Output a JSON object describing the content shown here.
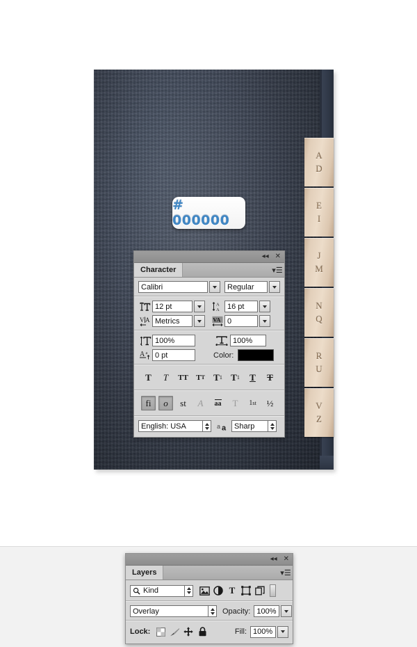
{
  "artwork": {
    "hex_label": "# 000000",
    "hex_label_color": "#3f86c4",
    "cover_color": "#39404e",
    "spine_color": "#2d3543",
    "tab_color": "#e2cfba",
    "tab_text_color": "#8a6f52",
    "index_tabs": [
      {
        "name": "tab-a-d",
        "top": "A",
        "bottom": "D"
      },
      {
        "name": "tab-e-i",
        "top": "E",
        "bottom": "I"
      },
      {
        "name": "tab-j-m",
        "top": "J",
        "bottom": "M"
      },
      {
        "name": "tab-n-q",
        "top": "N",
        "bottom": "Q"
      },
      {
        "name": "tab-r-u",
        "top": "R",
        "bottom": "U"
      },
      {
        "name": "tab-v-z",
        "top": "V",
        "bottom": "Z"
      }
    ]
  },
  "character_panel": {
    "tab_label": "Character",
    "collapse_icon": "◂◂",
    "close_icon": "✕",
    "menu_icon": "▾☰",
    "font_family": {
      "value": "Calibri",
      "icon": "font-family-field"
    },
    "font_style": {
      "value": "Regular",
      "icon": "font-style-field"
    },
    "font_size": {
      "value": "12 pt",
      "icon": "font-size-icon"
    },
    "leading": {
      "value": "16 pt",
      "icon": "leading-icon"
    },
    "kerning": {
      "value": "Metrics",
      "icon": "kerning-icon"
    },
    "tracking": {
      "value": "0",
      "icon": "tracking-icon"
    },
    "vertical_scale": {
      "value": "100%",
      "icon": "vertical-scale-icon"
    },
    "horizontal_scale": {
      "value": "100%",
      "icon": "horizontal-scale-icon"
    },
    "baseline_shift": {
      "value": "0 pt",
      "icon": "baseline-shift-icon"
    },
    "color_label": "Color:",
    "color_value": "#000000",
    "style_buttons": [
      {
        "name": "faux-bold-button",
        "glyph": "T",
        "state": "off"
      },
      {
        "name": "faux-italic-button",
        "glyph": "T",
        "state": "off"
      },
      {
        "name": "all-caps-button",
        "glyph": "TT",
        "state": "off"
      },
      {
        "name": "small-caps-button",
        "glyph": "TT",
        "state": "off"
      },
      {
        "name": "superscript-button",
        "glyph": "T",
        "state": "off"
      },
      {
        "name": "subscript-button",
        "glyph": "T",
        "state": "off"
      },
      {
        "name": "underline-button",
        "glyph": "T",
        "state": "off"
      },
      {
        "name": "strikethrough-button",
        "glyph": "T",
        "state": "off"
      }
    ],
    "opentype_buttons": [
      {
        "name": "standard-ligatures-button",
        "glyph": "fi",
        "state": "on"
      },
      {
        "name": "contextual-alternates-button",
        "glyph": "ɔ",
        "state": "on"
      },
      {
        "name": "discretionary-ligatures-button",
        "glyph": "st",
        "state": "off"
      },
      {
        "name": "swash-button",
        "glyph": "A",
        "state": "disabled"
      },
      {
        "name": "stylistic-alternates-button",
        "glyph": "aa",
        "state": "off"
      },
      {
        "name": "titling-alternates-button",
        "glyph": "T",
        "state": "disabled"
      },
      {
        "name": "ordinals-button",
        "glyph": "1st",
        "state": "off"
      },
      {
        "name": "fractions-button",
        "glyph": "½",
        "state": "off"
      }
    ],
    "language": "English: USA",
    "antialias_icon": "aa",
    "antialias_method": "Sharp"
  },
  "layers_panel": {
    "tab_label": "Layers",
    "collapse_icon": "◂◂",
    "close_icon": "✕",
    "menu_icon": "▾☰",
    "filter_kind": "Kind",
    "filter_search_icon": "search-icon",
    "filter_icons": [
      {
        "name": "filter-pixel-layers-icon",
        "title": "Pixel layers"
      },
      {
        "name": "filter-adjustment-layers-icon",
        "title": "Adjustment layers"
      },
      {
        "name": "filter-type-layers-icon",
        "title": "Type layers"
      },
      {
        "name": "filter-shape-layers-icon",
        "title": "Shape layers"
      },
      {
        "name": "filter-smart-objects-icon",
        "title": "Smart objects"
      }
    ],
    "filter_toggle_icon": "filter-enable-toggle",
    "blend_mode": "Overlay",
    "opacity_label": "Opacity:",
    "opacity_value": "100%",
    "lock_label": "Lock:",
    "lock_icons": [
      {
        "name": "lock-transparent-pixels-icon"
      },
      {
        "name": "lock-image-pixels-icon"
      },
      {
        "name": "lock-position-icon"
      },
      {
        "name": "lock-all-icon"
      }
    ],
    "fill_label": "Fill:",
    "fill_value": "100%"
  }
}
